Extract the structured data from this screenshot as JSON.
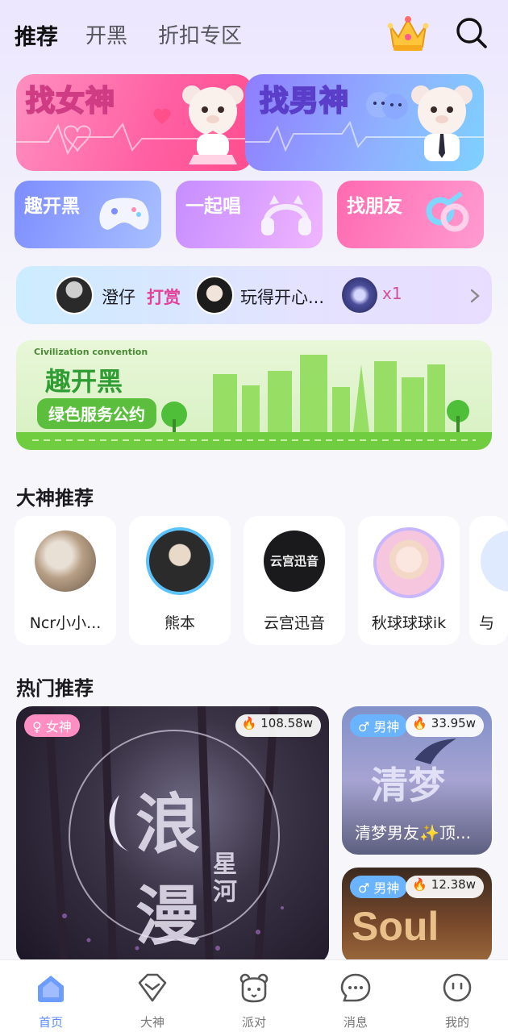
{
  "header": {
    "tabs": [
      {
        "label": "推荐",
        "active": true
      },
      {
        "label": "开黑",
        "active": false
      },
      {
        "label": "折扣专区",
        "active": false
      }
    ],
    "icons": [
      "crown-icon",
      "search-icon"
    ]
  },
  "banners": {
    "goddess": "找女神",
    "god": "找男神"
  },
  "mini_banners": [
    {
      "label": "趣开黑",
      "icon": "gamepad-icon"
    },
    {
      "label": "一起唱",
      "icon": "headphones-icon"
    },
    {
      "label": "找朋友",
      "icon": "gender-icon"
    }
  ],
  "tip_bar": {
    "sender": "澄仔",
    "action": "打赏",
    "receiver": "玩得开心...",
    "gift_count": "x1"
  },
  "green_banner": {
    "small": "Civilization convention",
    "title": "趣开黑",
    "subtitle": "绿色服务公约"
  },
  "masters": {
    "title": "大神推荐",
    "items": [
      {
        "name": "Ncr小小..."
      },
      {
        "name": "熊本"
      },
      {
        "name": "云宫迅音",
        "avatar_text": "云宫迅音"
      },
      {
        "name": "秋球球球ik"
      },
      {
        "name": "与"
      }
    ]
  },
  "hot": {
    "title": "热门推荐",
    "items": [
      {
        "gender": "♀ 女神",
        "heat": "108.58w",
        "art_1": "浪",
        "art_2": "漫",
        "art_3": "星河"
      },
      {
        "gender": "♂ 男神",
        "heat": "33.95w",
        "art": "清梦",
        "name": "清梦男友✨顶..."
      },
      {
        "gender": "♂ 男神",
        "heat": "12.38w",
        "art": "Soul"
      }
    ]
  },
  "bottom_nav": [
    {
      "label": "首页",
      "active": true
    },
    {
      "label": "大神"
    },
    {
      "label": "派对"
    },
    {
      "label": "消息"
    },
    {
      "label": "我的"
    }
  ],
  "colors": {
    "accent": "#5a8bff",
    "tip_action": "#e1419a",
    "green": "#2f9c34"
  }
}
